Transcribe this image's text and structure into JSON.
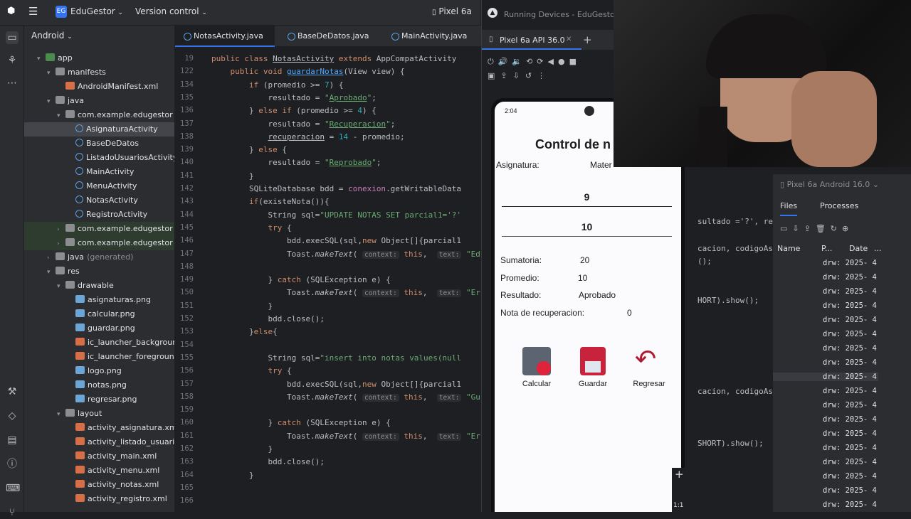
{
  "topbar": {
    "project": "EduGestor",
    "project_badge": "EG",
    "vcs": "Version control",
    "device": "Pixel 6a"
  },
  "project_panel": {
    "title": "Android",
    "items": [
      {
        "label": "app",
        "type": "mod",
        "indent": 1,
        "tw": "▾"
      },
      {
        "label": "manifests",
        "type": "folder",
        "indent": 2,
        "tw": "▾"
      },
      {
        "label": "AndroidManifest.xml",
        "type": "xml",
        "indent": 3,
        "tw": ""
      },
      {
        "label": "java",
        "type": "folder",
        "indent": 2,
        "tw": "▾"
      },
      {
        "label": "com.example.edugestor",
        "type": "pkg",
        "indent": 3,
        "tw": "▾"
      },
      {
        "label": "AsignaturaActivity",
        "type": "cls",
        "indent": 4,
        "tw": "",
        "sel": true
      },
      {
        "label": "BaseDeDatos",
        "type": "cls",
        "indent": 4,
        "tw": ""
      },
      {
        "label": "ListadoUsuariosActivity",
        "type": "cls",
        "indent": 4,
        "tw": ""
      },
      {
        "label": "MainActivity",
        "type": "cls",
        "indent": 4,
        "tw": ""
      },
      {
        "label": "MenuActivity",
        "type": "cls",
        "indent": 4,
        "tw": ""
      },
      {
        "label": "NotasActivity",
        "type": "cls",
        "indent": 4,
        "tw": ""
      },
      {
        "label": "RegistroActivity",
        "type": "cls",
        "indent": 4,
        "tw": ""
      },
      {
        "label": "com.example.edugestor",
        "suffix": "(a",
        "type": "pkg",
        "indent": 3,
        "tw": "›",
        "hl": true
      },
      {
        "label": "com.example.edugestor",
        "suffix": "(t",
        "type": "pkg",
        "indent": 3,
        "tw": "›",
        "hl": true
      },
      {
        "label": "java",
        "suffix": "(generated)",
        "type": "folder",
        "indent": 2,
        "tw": "›"
      },
      {
        "label": "res",
        "type": "folder",
        "indent": 2,
        "tw": "▾"
      },
      {
        "label": "drawable",
        "type": "folder",
        "indent": 3,
        "tw": "▾"
      },
      {
        "label": "asignaturas.png",
        "type": "png",
        "indent": 4,
        "tw": ""
      },
      {
        "label": "calcular.png",
        "type": "png",
        "indent": 4,
        "tw": ""
      },
      {
        "label": "guardar.png",
        "type": "png",
        "indent": 4,
        "tw": ""
      },
      {
        "label": "ic_launcher_background",
        "type": "xml",
        "indent": 4,
        "tw": ""
      },
      {
        "label": "ic_launcher_foreground",
        "type": "xml",
        "indent": 4,
        "tw": ""
      },
      {
        "label": "logo.png",
        "type": "png",
        "indent": 4,
        "tw": ""
      },
      {
        "label": "notas.png",
        "type": "png",
        "indent": 4,
        "tw": ""
      },
      {
        "label": "regresar.png",
        "type": "png",
        "indent": 4,
        "tw": ""
      },
      {
        "label": "layout",
        "type": "folder",
        "indent": 3,
        "tw": "▾"
      },
      {
        "label": "activity_asignatura.xml",
        "type": "xml",
        "indent": 4,
        "tw": ""
      },
      {
        "label": "activity_listado_usuarios",
        "type": "xml",
        "indent": 4,
        "tw": ""
      },
      {
        "label": "activity_main.xml",
        "type": "xml",
        "indent": 4,
        "tw": ""
      },
      {
        "label": "activity_menu.xml",
        "type": "xml",
        "indent": 4,
        "tw": ""
      },
      {
        "label": "activity_notas.xml",
        "type": "xml",
        "indent": 4,
        "tw": ""
      },
      {
        "label": "activity_registro.xml",
        "type": "xml",
        "indent": 4,
        "tw": ""
      }
    ]
  },
  "editor": {
    "tabs": [
      "NotasActivity.java",
      "BaseDeDatos.java",
      "MainActivity.java"
    ],
    "lines": [
      {
        "n": "19",
        "html": "<span class=\"kw\">public class</span> <u>NotasActivity</u> <span class=\"kw\">extends</span> AppCompatActivity",
        "ind": 0
      },
      {
        "n": "122",
        "html": "<span class=\"kw\">public void</span> <span class=\"fn\"><u>guardarNotas</u></span>(View view) {",
        "ind": 1
      },
      {
        "n": "134",
        "html": "<span class=\"kw\">if</span> (promedio &gt;= <span class=\"num\">7</span>) {",
        "ind": 2
      },
      {
        "n": "135",
        "html": "resultado = <span class=\"str\">\"<u>Aprobado</u>\"</span>;",
        "ind": 3
      },
      {
        "n": "136",
        "html": "} <span class=\"kw\">else if</span> (promedio &gt;= <span class=\"num\">4</span>) {",
        "ind": 2
      },
      {
        "n": "137",
        "html": "resultado = <span class=\"str\">\"<u>Recuperacion</u>\"</span>;",
        "ind": 3
      },
      {
        "n": "138",
        "html": "<u>recuperacion</u> = <span class=\"num\">14</span> - promedio;",
        "ind": 3
      },
      {
        "n": "139",
        "html": "} <span class=\"kw\">else</span> {",
        "ind": 2
      },
      {
        "n": "140",
        "html": "resultado = <span class=\"str\">\"<u>Reprobado</u>\"</span>;",
        "ind": 3
      },
      {
        "n": "141",
        "html": "}",
        "ind": 2
      },
      {
        "n": "142",
        "html": "SQLiteDatabase bdd = <span class=\"st\">conexion</span>.getWritableData",
        "ind": 2
      },
      {
        "n": "143",
        "html": "<span class=\"kw\">if</span>(existeNota()){",
        "ind": 2
      },
      {
        "n": "144",
        "html": "String sql=<span class=\"str\">\"UPDATE NOTAS SET parcial1='?'</span>",
        "ind": 3
      },
      {
        "n": "145",
        "html": "<span class=\"kw\">try</span> {",
        "ind": 3
      },
      {
        "n": "146",
        "html": "bdd.execSQL(sql,<span class=\"kw\">new</span> Object[]{parcial1",
        "ind": 4
      },
      {
        "n": "147",
        "html": "Toast.<i>makeText</i>( <span class=\"hint\">context:</span> <span class=\"kw\">this</span>,  <span class=\"hint\">text:</span> <span class=\"str\">\"Ed</span>",
        "ind": 4
      },
      {
        "n": "148",
        "html": "",
        "ind": 4
      },
      {
        "n": "149",
        "html": "} <span class=\"kw\">catch</span> (SQLException e) {",
        "ind": 3
      },
      {
        "n": "150",
        "html": "Toast.<i>makeText</i>( <span class=\"hint\">context:</span> <span class=\"kw\">this</span>,  <span class=\"hint\">text:</span> <span class=\"str\">\"Er</span>",
        "ind": 4
      },
      {
        "n": "151",
        "html": "}",
        "ind": 3
      },
      {
        "n": "152",
        "html": "bdd.close();",
        "ind": 3
      },
      {
        "n": "153",
        "html": "}<span class=\"kw\">else</span>{",
        "ind": 2
      },
      {
        "n": "154",
        "html": "",
        "ind": 3
      },
      {
        "n": "155",
        "html": "String sql=<span class=\"str\">\"insert into notas values(null</span>",
        "ind": 3
      },
      {
        "n": "156",
        "html": "<span class=\"kw\">try</span> {",
        "ind": 3
      },
      {
        "n": "157",
        "html": "bdd.execSQL(sql,<span class=\"kw\">new</span> Object[]{parcial1",
        "ind": 4
      },
      {
        "n": "158",
        "html": "Toast.<i>makeText</i>( <span class=\"hint\">context:</span> <span class=\"kw\">this</span>,  <span class=\"hint\">text:</span> <span class=\"str\">\"Gu</span>",
        "ind": 4
      },
      {
        "n": "159",
        "html": "",
        "ind": 3
      },
      {
        "n": "160",
        "html": "} <span class=\"kw\">catch</span> (SQLException e) {",
        "ind": 3
      },
      {
        "n": "161",
        "html": "Toast.<i>makeText</i>( <span class=\"hint\">context:</span> <span class=\"kw\">this</span>,  <span class=\"hint\">text:</span> <span class=\"str\">\"Er</span>",
        "ind": 4
      },
      {
        "n": "162",
        "html": "}",
        "ind": 3
      },
      {
        "n": "163",
        "html": "bdd.close();",
        "ind": 3
      },
      {
        "n": "164",
        "html": "}",
        "ind": 2
      },
      {
        "n": "165",
        "html": "",
        "ind": 2
      },
      {
        "n": "166",
        "html": "",
        "ind": 2
      }
    ]
  },
  "running_devices": {
    "title": "Running Devices - EduGestor",
    "device_tab": "Pixel 6a API 36.0"
  },
  "phone": {
    "time": "2:04",
    "title": "Control de n",
    "asignatura_label": "Asignatura:",
    "asignatura_value": "Mater",
    "nota1": "9",
    "nota2": "10",
    "sumatoria_label": "Sumatoria:",
    "sumatoria_value": "20",
    "promedio_label": "Promedio:",
    "promedio_value": "10",
    "resultado_label": "Resultado:",
    "resultado_value": "Aprobado",
    "recuperacion_label": "Nota de recuperacion:",
    "recuperacion_value": "0",
    "btn_calcular": "Calcular",
    "btn_guardar": "Guardar",
    "btn_regresar": "Regresar"
  },
  "zoom": {
    "plus": "+",
    "ratio": "1:1"
  },
  "right_code": {
    "l1": "sultado ='?', re",
    "l2": "cacion, codigoAs",
    "l3": "();",
    "l4": "HORT).show();",
    "l5": "cacion, codigoAs",
    "l6": "SHORT).show();"
  },
  "device_explorer": {
    "device": "Pixel 6a Android 16.0",
    "tab_files": "Files",
    "tab_processes": "Processes",
    "col_name": "Name",
    "col_p": "P...",
    "col_date": "Date",
    "col_more": "...",
    "row_text": "drw: 2025- 4",
    "rows": 18
  }
}
